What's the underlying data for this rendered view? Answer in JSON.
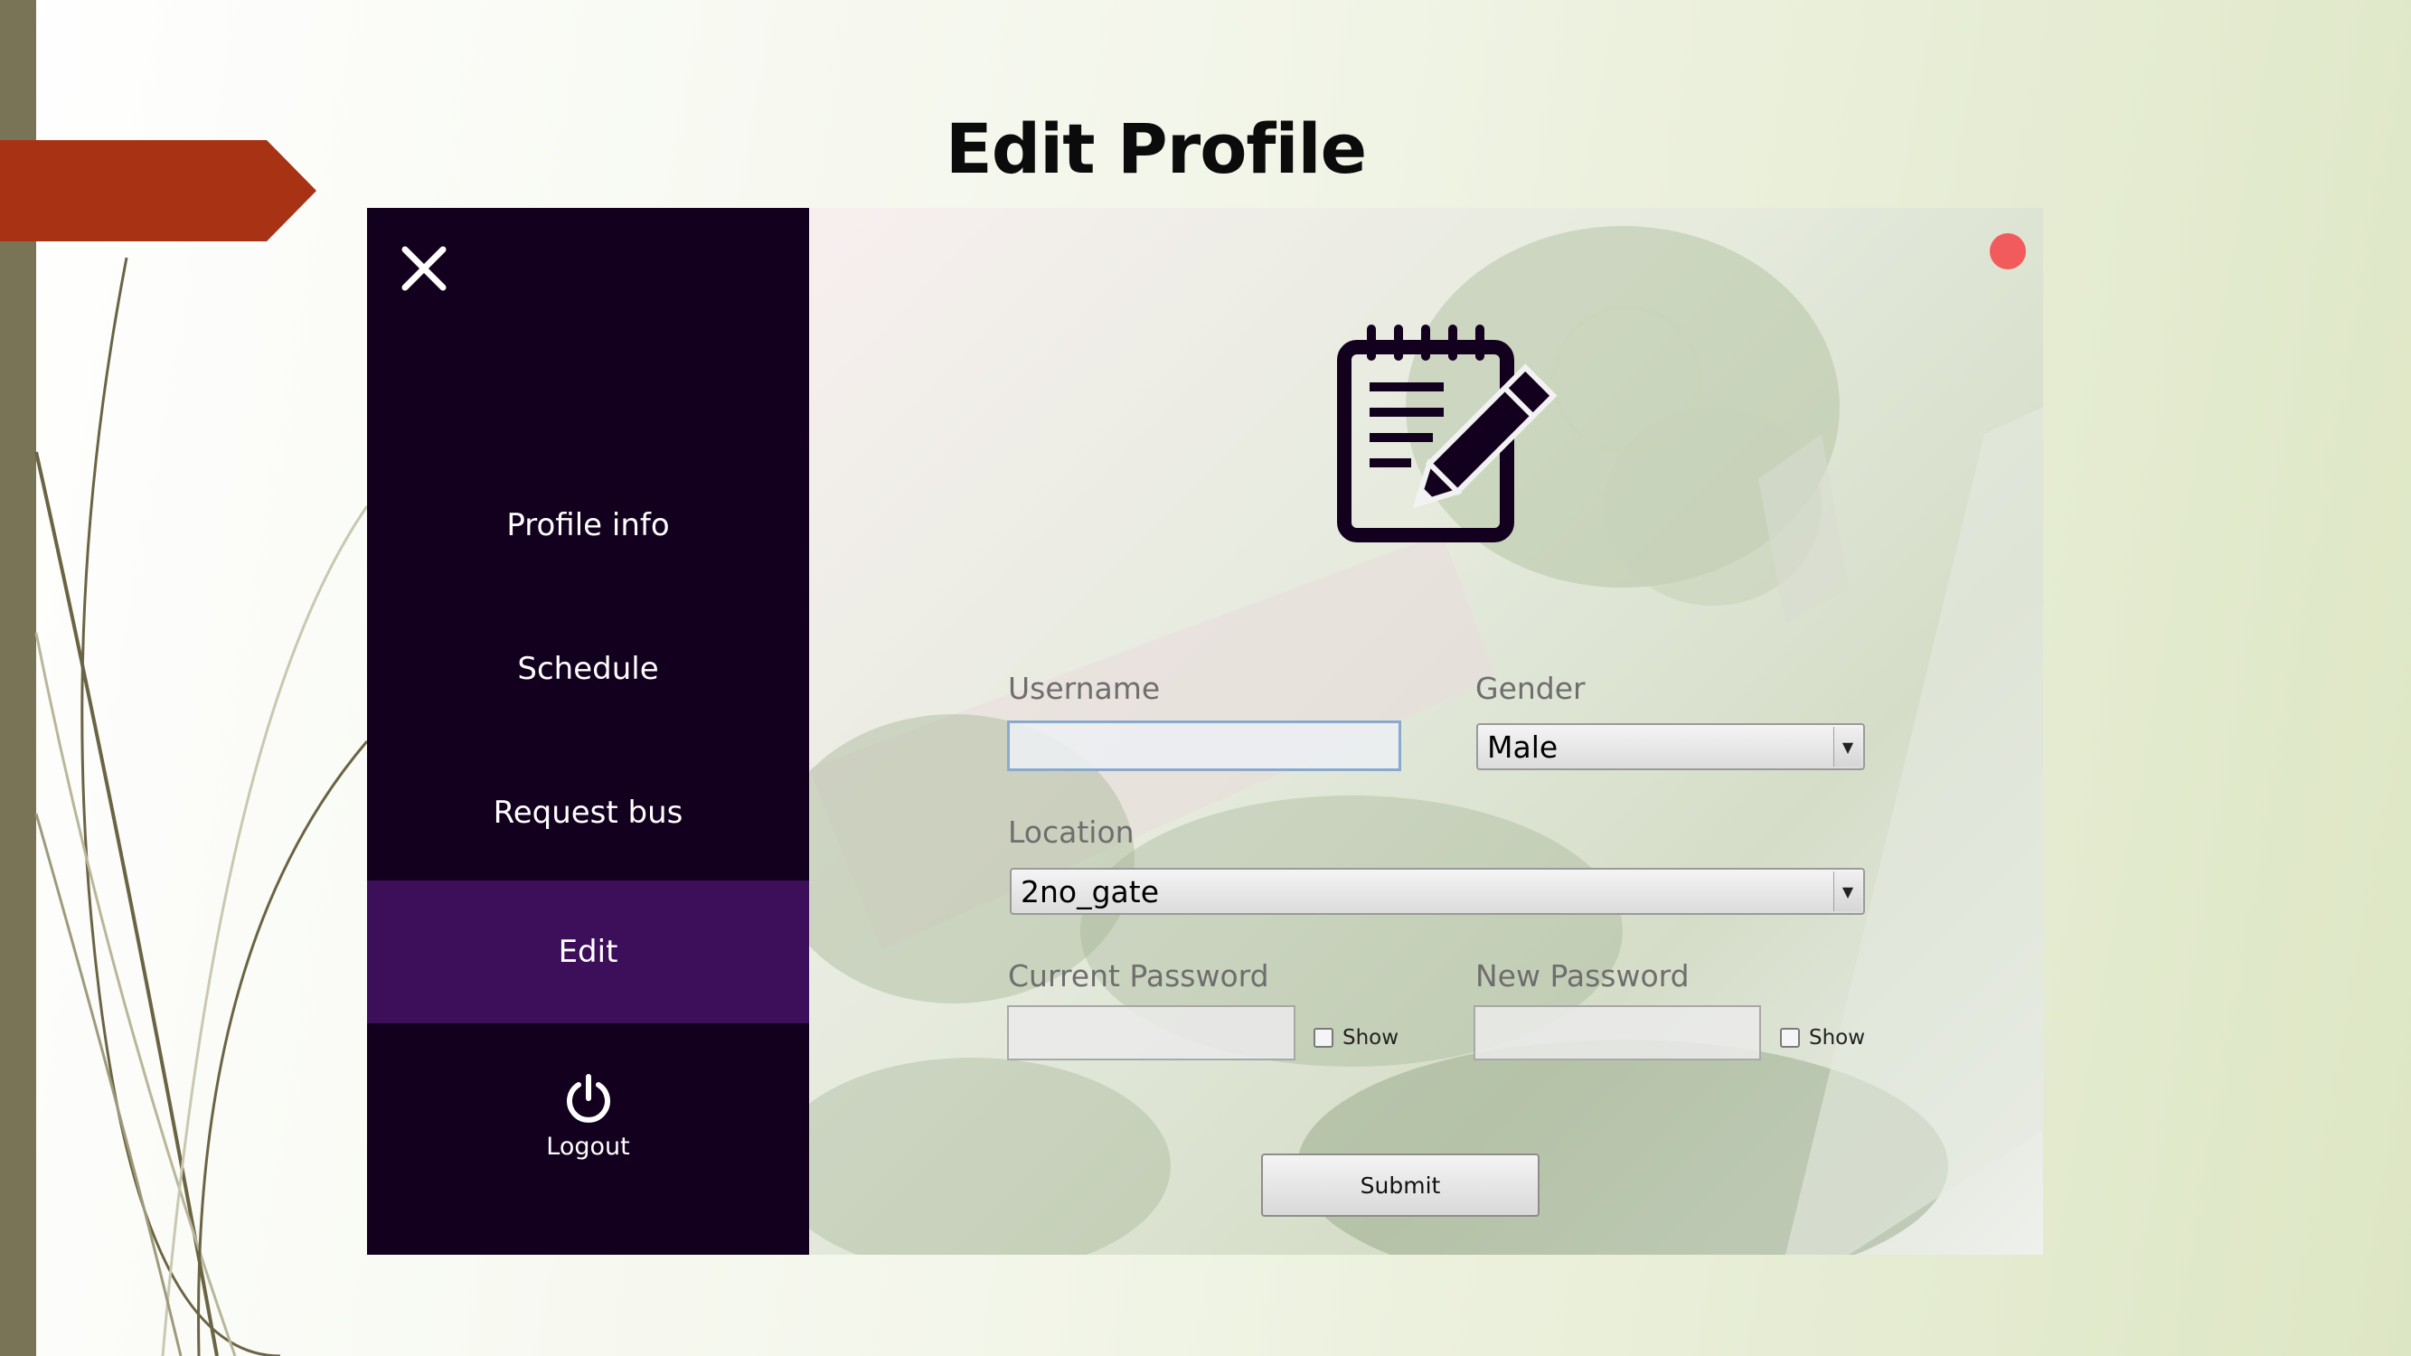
{
  "slide": {
    "title": "Edit Profile"
  },
  "menu": {
    "items": [
      {
        "label": "Profile info"
      },
      {
        "label": "Schedule"
      },
      {
        "label": "Request bus"
      },
      {
        "label": "Edit"
      }
    ],
    "active_item": "Edit",
    "logout_label": "Logout",
    "background_color": "#12001e",
    "active_color": "#3d0f5a"
  },
  "form": {
    "username_label": "Username",
    "username_value": "",
    "gender_label": "Gender",
    "gender_value": "Male",
    "location_label": "Location",
    "location_value": "2no_gate",
    "current_password_label": "Current Password",
    "current_password_value": "",
    "new_password_label": "New Password",
    "new_password_value": "",
    "show_label": "Show",
    "submit_label": "Submit"
  },
  "icons": {
    "close": "close-icon",
    "edit": "notepad-pencil-icon",
    "logout": "power-icon",
    "status": "status-dot"
  },
  "colors": {
    "accent_red": "#a83214",
    "status_dot": "#f25b5b"
  }
}
